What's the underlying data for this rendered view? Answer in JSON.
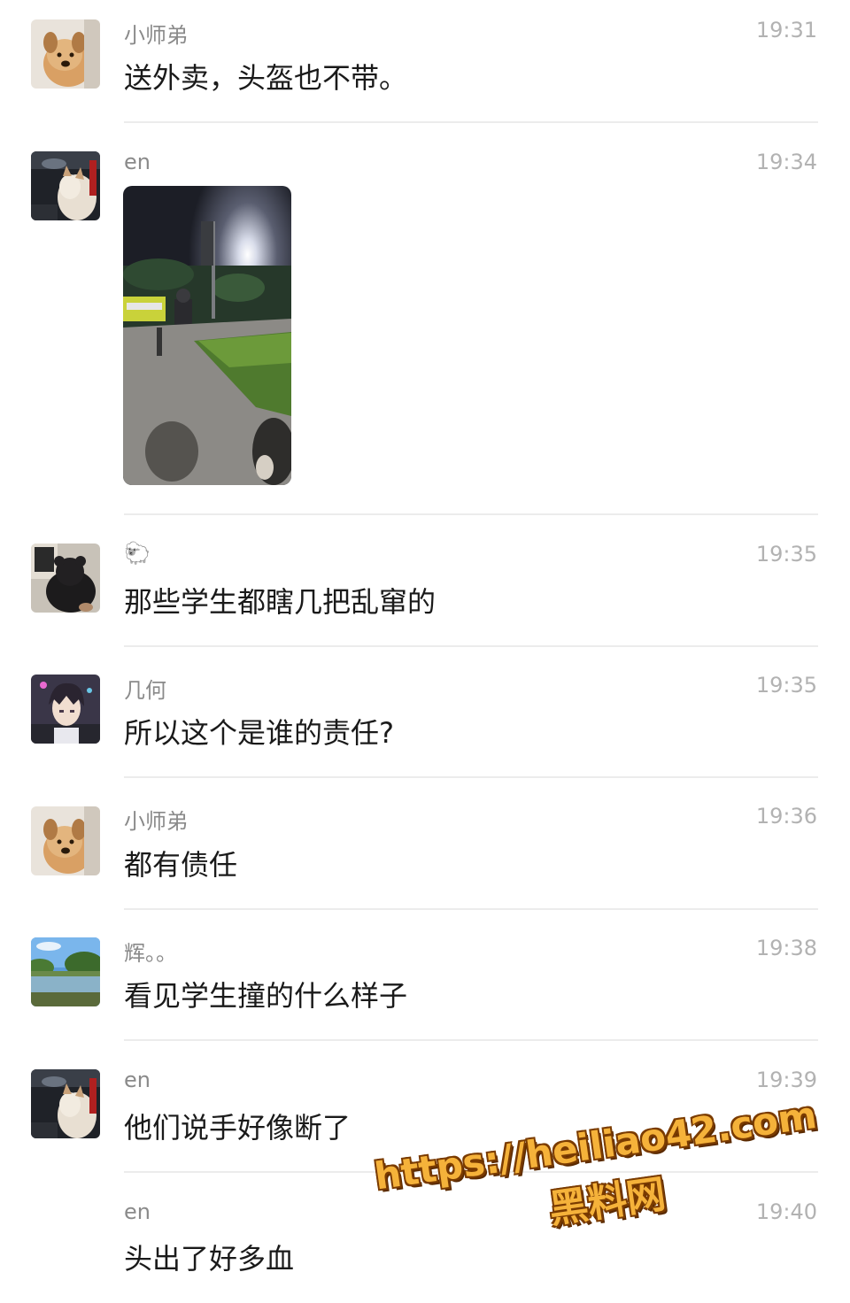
{
  "messages": [
    {
      "name": "小师弟",
      "time": "19:31",
      "text": "送外卖，头盔也不带。",
      "avatar": "dog-avatar"
    },
    {
      "name": "en",
      "time": "19:34",
      "image": "street-night-photo",
      "avatar": "cat-car-avatar"
    },
    {
      "name": "🐑",
      "time": "19:35",
      "text": "那些学生都瞎几把乱窜的",
      "avatar": "black-bear-avatar"
    },
    {
      "name": "几何",
      "time": "19:35",
      "text": "所以这个是谁的责任?",
      "avatar": "anime-boy-avatar"
    },
    {
      "name": "小师弟",
      "time": "19:36",
      "text": "都有债任",
      "avatar": "dog-avatar"
    },
    {
      "name": "辉。。",
      "time": "19:38",
      "text": "看见学生撞的什么样子",
      "avatar": "lake-avatar"
    },
    {
      "name": "en",
      "time": "19:39",
      "text": "他们说手好像断了",
      "avatar": "cat-car-avatar"
    },
    {
      "name": "en",
      "time": "19:40",
      "text": "头出了好多血"
    }
  ],
  "watermark": {
    "url": "https://heiliao42.com",
    "site": "黑料网"
  }
}
